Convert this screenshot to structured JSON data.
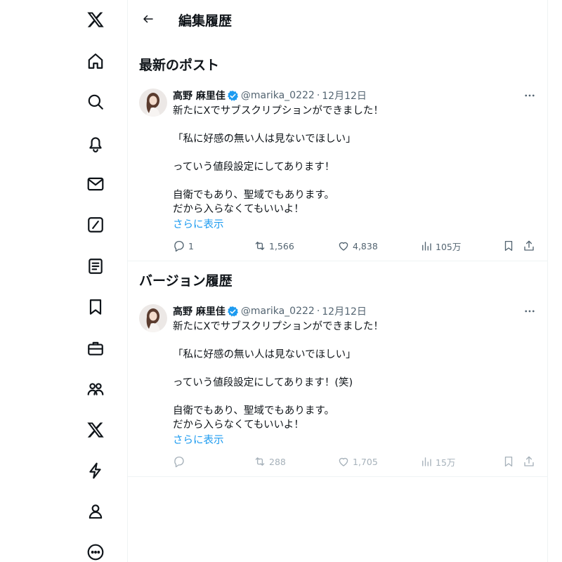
{
  "sidebar": {
    "items": [
      {
        "icon": "x-logo-icon"
      },
      {
        "icon": "home-icon"
      },
      {
        "icon": "search-icon"
      },
      {
        "icon": "bell-icon"
      },
      {
        "icon": "mail-icon"
      },
      {
        "icon": "grok-icon"
      },
      {
        "icon": "lists-icon"
      },
      {
        "icon": "bookmark-icon"
      },
      {
        "icon": "jobs-icon"
      },
      {
        "icon": "communities-icon"
      },
      {
        "icon": "premium-icon"
      },
      {
        "icon": "verified-orgs-icon"
      },
      {
        "icon": "profile-icon"
      },
      {
        "icon": "more-icon"
      }
    ]
  },
  "header": {
    "title": "編集履歴"
  },
  "latest": {
    "section_title": "最新のポスト",
    "tweet": {
      "author": "高野 麻里佳",
      "handle": "@marika_0222",
      "separator": "·",
      "date": "12月12日",
      "lines": [
        "新たにXでサブスクリプションができました！",
        "",
        "「私に好感の無い人は見ないでほしい」",
        "",
        "っていう値段設定にしてあります！",
        "",
        "自衛でもあり、聖域でもあります。",
        "だから入らなくてもいいよ！"
      ],
      "show_more": "さらに表示",
      "replies": "1",
      "reposts": "1,566",
      "likes": "4,838",
      "views": "105万"
    }
  },
  "history": {
    "section_title": "バージョン履歴",
    "tweet": {
      "author": "高野 麻里佳",
      "handle": "@marika_0222",
      "separator": "·",
      "date": "12月12日",
      "lines": [
        "新たにXでサブスクリプションができました！",
        "",
        "「私に好感の無い人は見ないでほしい」",
        "",
        "っていう値段設定にしてあります！(笑)",
        "",
        "自衛でもあり、聖域でもあります。",
        "だから入らなくてもいいよ！"
      ],
      "show_more": "さらに表示",
      "replies": "",
      "reposts": "288",
      "likes": "1,705",
      "views": "15万"
    }
  },
  "colors": {
    "text": "#0f1419",
    "secondary": "#536471",
    "faded": "#a6b1ba",
    "link": "#1d9bf0",
    "verified": "#1d9bf0",
    "border": "#eff3f4"
  }
}
